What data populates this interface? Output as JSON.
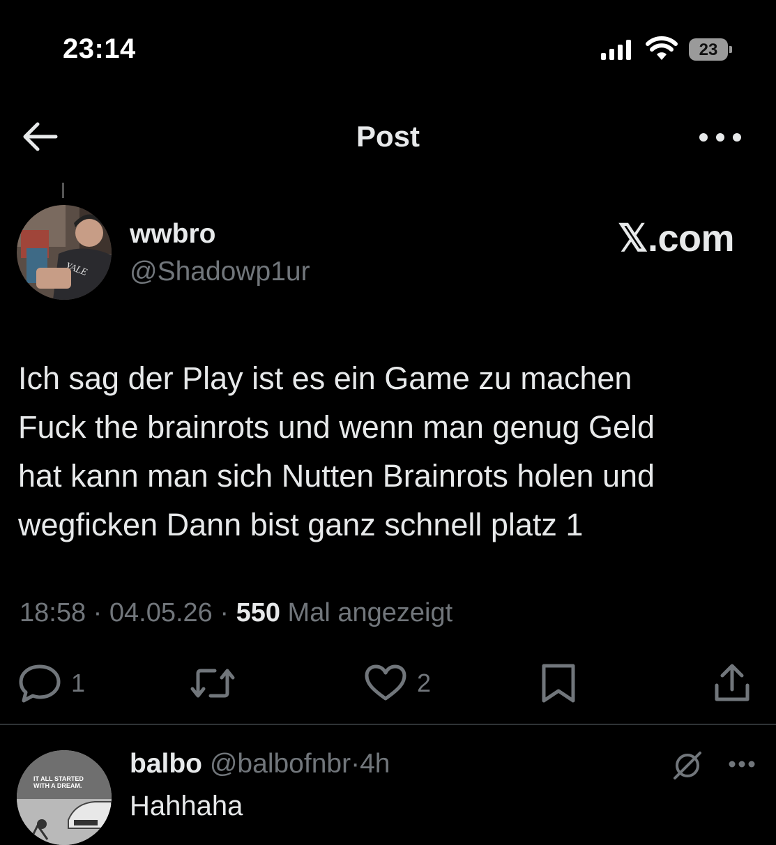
{
  "status_bar": {
    "time": "23:14",
    "battery": "23"
  },
  "nav": {
    "title": "Post"
  },
  "post": {
    "author_name": "wwbro",
    "author_handle": "@Shadowp1ur",
    "source_label": "𝕏.com",
    "avatar_text": "YALE",
    "text": "Ich sag der Play ist es ein Game zu machen\nFuck the brainrots und wenn man genug Geld\nhat kann man sich Nutten Brainrots holen und\nwegficken Dann bist ganz schnell platz 1",
    "time": "18:58",
    "date": "04.05.26",
    "views": "550",
    "views_label": "Mal angezeigt",
    "separator": "·",
    "replies": "1",
    "likes": "2"
  },
  "reply": {
    "author_name": "balbo",
    "author_handle": "@balbofnbr",
    "age": "4h",
    "text": "Hahhaha",
    "avatar_text_1": "IT ALL STARTED",
    "avatar_text_2": "WITH A DREAM."
  },
  "colors": {
    "background": "#000000",
    "text": "#e7e9ea",
    "muted": "#71767b",
    "divider": "#2f3336"
  },
  "icons": [
    "back-arrow-icon",
    "more-icon",
    "reply-icon",
    "repost-icon",
    "like-icon",
    "bookmark-icon",
    "share-icon",
    "mute-icon"
  ]
}
